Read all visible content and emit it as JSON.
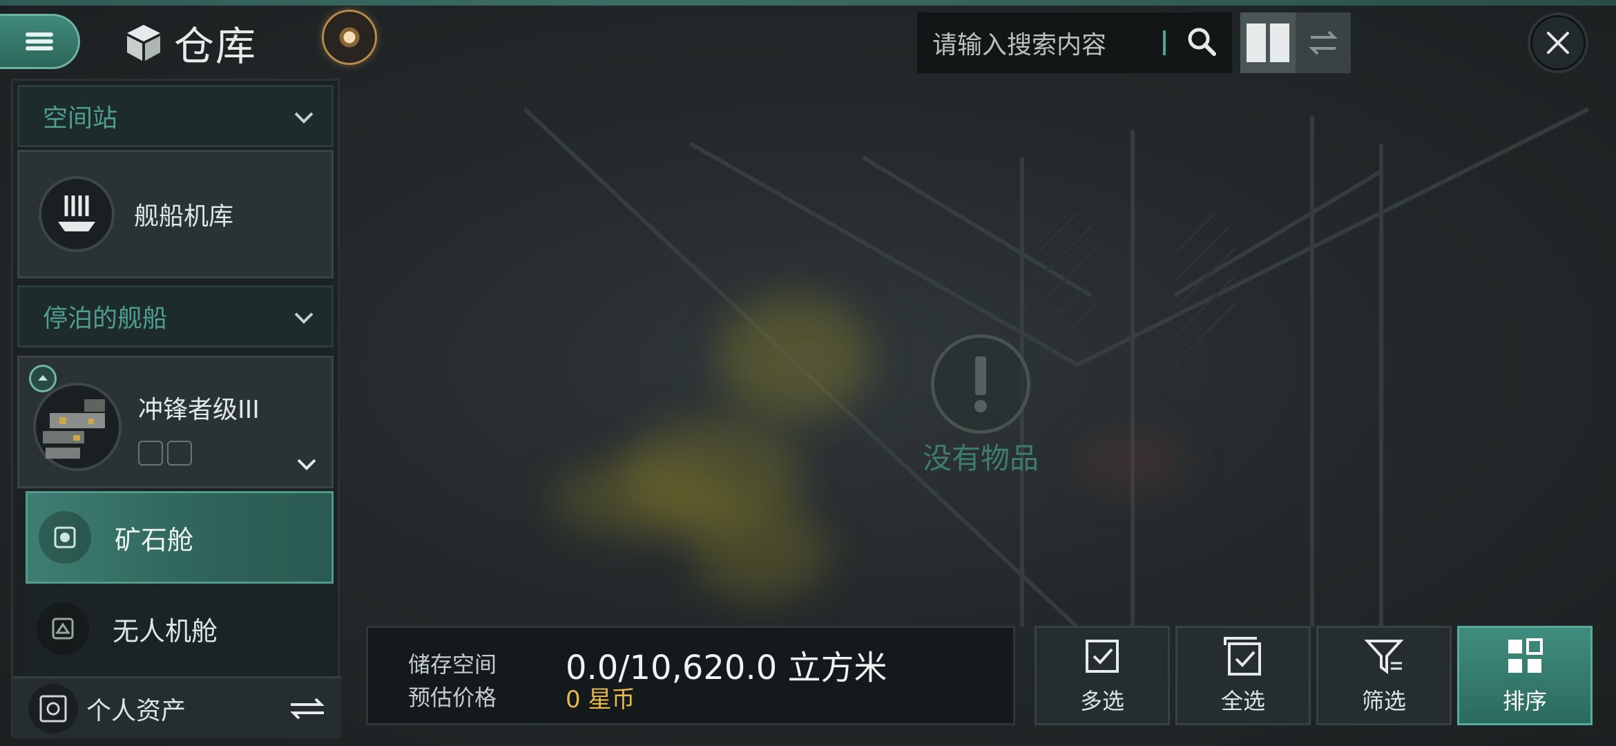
{
  "header": {
    "title": "仓库",
    "icons": [
      "menu-icon",
      "cube-icon",
      "radar-icon",
      "search-icon",
      "grid-view-icon",
      "swap-icon",
      "close-icon"
    ]
  },
  "search": {
    "placeholder": "请输入搜索内容"
  },
  "sidebar": {
    "section_station": "空间站",
    "hangar_label": "舰船机库",
    "section_docked": "停泊的舰船",
    "ship_name": "冲锋者级III",
    "holds": [
      {
        "label": "矿石舱",
        "selected": true
      },
      {
        "label": "无人机舱",
        "selected": false
      }
    ],
    "assets_label": "个人资产"
  },
  "empty_state": {
    "label": "没有物品"
  },
  "storage": {
    "space_label": "储存空间",
    "space_value": "0.0/10,620.0 立方米",
    "price_label": "预估价格",
    "price_value": "0 星币"
  },
  "actions": [
    {
      "label": "多选",
      "active": false
    },
    {
      "label": "全选",
      "active": false
    },
    {
      "label": "筛选",
      "active": false
    },
    {
      "label": "排序",
      "active": true
    }
  ],
  "colors": {
    "accent": "#3f8c7d",
    "accent_text": "#4e9f8d",
    "price": "#e7b94d",
    "background": "#1d2324"
  }
}
